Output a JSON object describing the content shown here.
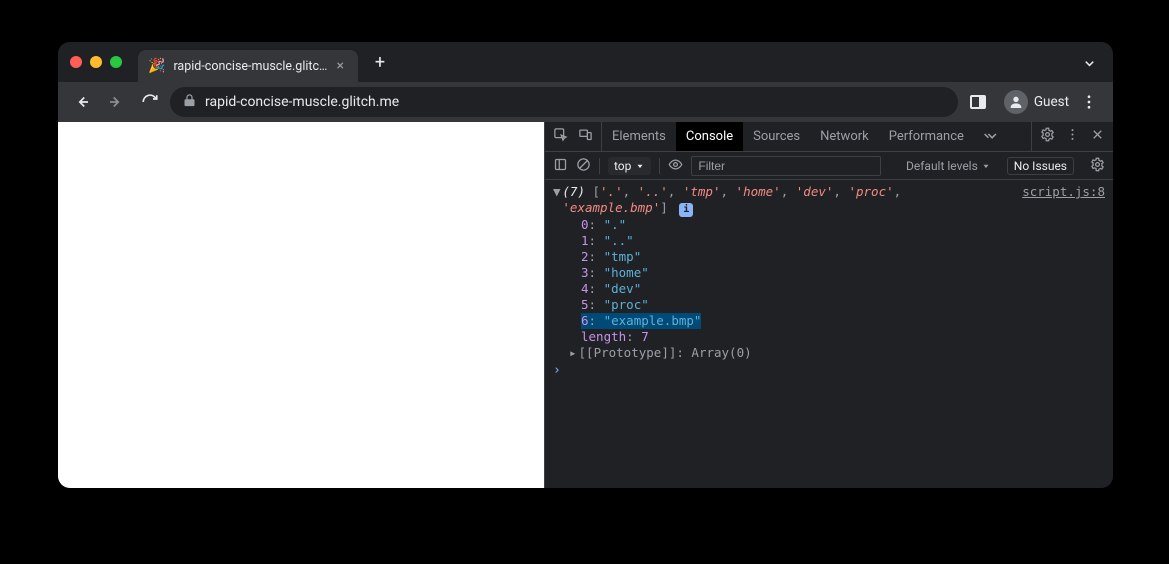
{
  "tab": {
    "title": "rapid-concise-muscle.glitch.m",
    "favicon": "🎉"
  },
  "url": "rapid-concise-muscle.glitch.me",
  "guest_label": "Guest",
  "devtools": {
    "tabs": {
      "elements": "Elements",
      "console": "Console",
      "sources": "Sources",
      "network": "Network",
      "performance": "Performance"
    },
    "console_toolbar": {
      "scope": "top",
      "filter_placeholder": "Filter",
      "levels": "Default levels",
      "issues": "No Issues"
    },
    "log": {
      "count_label": "(7)",
      "preview_items": [
        "'.'",
        "'..'",
        "'tmp'",
        "'home'",
        "'dev'",
        "'proc'",
        "'example.bmp'"
      ],
      "src": "script.js:8",
      "entries": [
        {
          "k": "0",
          "v": "\".\""
        },
        {
          "k": "1",
          "v": "\"..\""
        },
        {
          "k": "2",
          "v": "\"tmp\""
        },
        {
          "k": "3",
          "v": "\"home\""
        },
        {
          "k": "4",
          "v": "\"dev\""
        },
        {
          "k": "5",
          "v": "\"proc\""
        },
        {
          "k": "6",
          "v": "\"example.bmp\"",
          "highlight": true
        }
      ],
      "length": {
        "k": "length",
        "v": "7"
      },
      "prototype": "[[Prototype]]: Array(0)"
    }
  }
}
